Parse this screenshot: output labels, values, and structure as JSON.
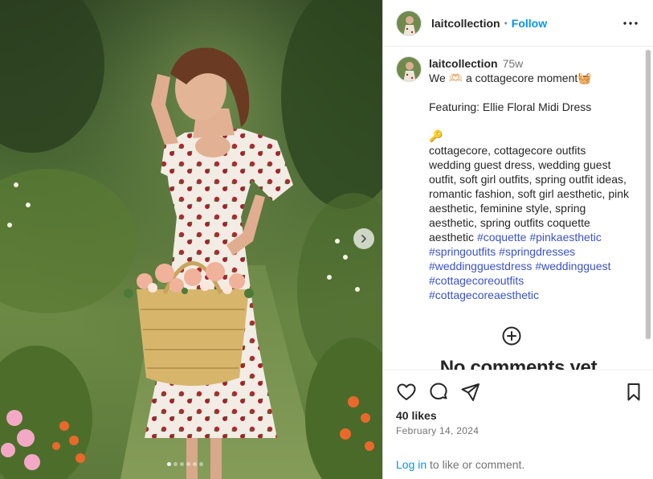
{
  "post": {
    "username": "laitcollection",
    "follow_label": "Follow",
    "separator": "•",
    "time_ago": "75w",
    "caption": {
      "line1": "We 🫶🏻 a cottagecore moment🧺",
      "line2": "Featuring: Ellie Floral Midi Dress",
      "line3": "🔑",
      "line4": "cottagecore, cottagecore outfits wedding guest dress, wedding guest outfit, soft girl outfits, spring outfit ideas, romantic fashion, soft girl aesthetic, pink aesthetic, feminine style, spring aesthetic, spring outfits coquette aesthetic ",
      "hashtags": [
        "#coquette",
        "#pinkaesthetic",
        "#springoutfits",
        "#springdresses",
        "#weddingguestdress",
        "#weddingguest",
        "#cottagecoreoutfits",
        "#cottagecoreaesthetic"
      ]
    },
    "no_comments": "No comments yet",
    "likes": "40 likes",
    "date": "February 14, 2024",
    "login_link": "Log in",
    "login_rest": " to like or comment."
  },
  "carousel": {
    "slides": 6,
    "active": 0
  },
  "icons": {
    "more": "more-options-icon",
    "like": "heart-icon",
    "comment": "comment-bubble-icon",
    "share": "paper-plane-icon",
    "save": "bookmark-icon",
    "add_comment": "plus-circle-icon",
    "next": "chevron-right-icon"
  },
  "colors": {
    "accent": "#0095f6",
    "hashtag": "#3a52c8",
    "text": "#262626",
    "muted": "#737373"
  }
}
